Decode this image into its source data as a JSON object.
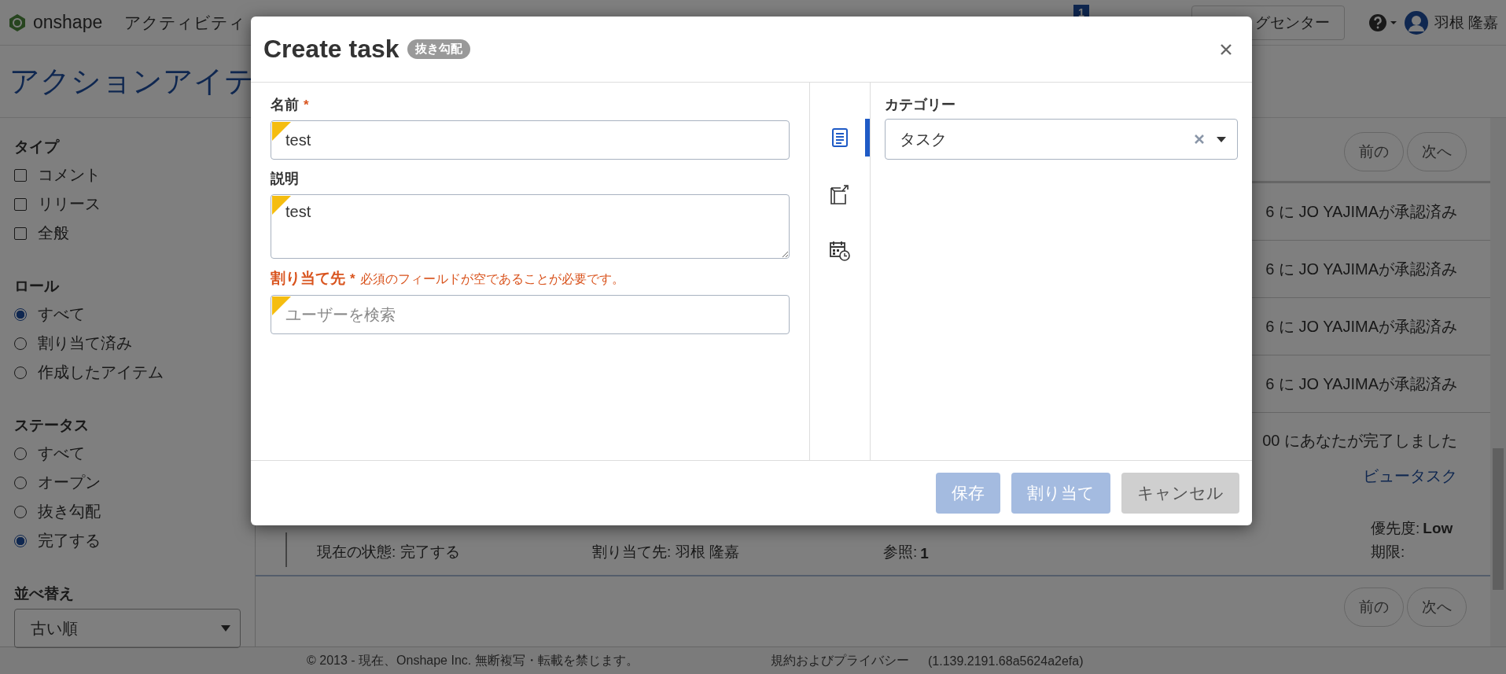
{
  "top_bar": {
    "logo_text": "onshape",
    "nav": [
      "アクティビティ"
    ],
    "notification_count": "1",
    "buttons": [
      "グセンター"
    ],
    "user_name": "羽根 隆嘉"
  },
  "page_title": "アクションアイテ",
  "sidebar": {
    "groups": [
      {
        "title": "タイプ",
        "kind": "checkbox",
        "options": [
          {
            "label": "コメント",
            "checked": false
          },
          {
            "label": "リリース",
            "checked": false
          },
          {
            "label": "全般",
            "checked": false
          }
        ]
      },
      {
        "title": "ロール",
        "kind": "radio",
        "options": [
          {
            "label": "すべて",
            "selected": true
          },
          {
            "label": "割り当て済み",
            "selected": false
          },
          {
            "label": "作成したアイテム",
            "selected": false
          }
        ]
      },
      {
        "title": "ステータス",
        "kind": "radio",
        "options": [
          {
            "label": "すべて",
            "selected": false
          },
          {
            "label": "オープン",
            "selected": false
          },
          {
            "label": "抜き勾配",
            "selected": false
          },
          {
            "label": "完了する",
            "selected": true
          }
        ]
      }
    ],
    "sort": {
      "label": "並べ替え",
      "value": "古い順"
    }
  },
  "list": {
    "pager_top": [
      "前の",
      "次へ"
    ],
    "rows": [
      {
        "text": "6 に JO YAJIMAが承認済み"
      },
      {
        "text": "6 に JO YAJIMAが承認済み"
      },
      {
        "text": "6 に JO YAJIMAが承認済み"
      },
      {
        "text": "6 に JO YAJIMAが承認済み"
      }
    ],
    "completed_text": "00 にあなたが完了しました",
    "link": "ビュータスク",
    "details": {
      "status": "現在の状態: 完了する",
      "assignee": "割り当て先: 羽根 隆嘉",
      "references_label": "参照:",
      "references": "1",
      "priority_label": "優先度:",
      "priority": "Low",
      "due_label": "期限:"
    },
    "pager_bottom": [
      "前の",
      "次へ"
    ]
  },
  "footer": [
    "© 2013 - 現在、Onshape Inc. 無断複写・転載を禁じます。",
    "規約およびプライバシー",
    "(1.139.2191.68a5624a2efa)"
  ],
  "dialog": {
    "title": "Create task",
    "status_badge": "抜き勾配",
    "fields": [
      {
        "kind": "input",
        "label": "名前",
        "required_mark": "*",
        "value": "test"
      },
      {
        "kind": "textarea",
        "label": "説明",
        "value": "test"
      },
      {
        "kind": "input",
        "label": "割り当て先",
        "required_mark": "*",
        "error": "必須のフィールドが空であることが必要です。",
        "placeholder": "ユーザーを検索"
      }
    ],
    "side_tabs": [
      {
        "kind": "details",
        "selected": true
      },
      {
        "kind": "link",
        "selected": false
      },
      {
        "kind": "schedule",
        "selected": false
      }
    ],
    "category": {
      "label": "カテゴリー",
      "value": "タスク"
    },
    "buttons": [
      {
        "label": "保存",
        "kind": "primary",
        "disabled": true
      },
      {
        "label": "割り当て",
        "kind": "primary",
        "disabled": true
      },
      {
        "label": "キャンセル",
        "kind": "secondary",
        "disabled": false
      }
    ]
  }
}
